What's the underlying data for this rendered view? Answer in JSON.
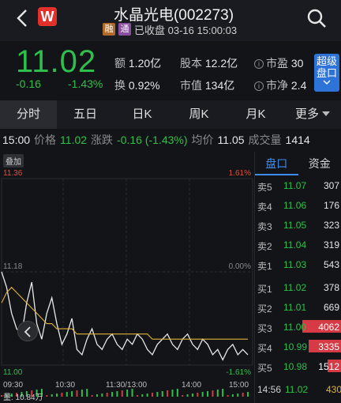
{
  "header": {
    "title": "水晶光电(002273)",
    "logo_text": "W",
    "tag_rong": "融",
    "tag_tong": "通",
    "status": "已收盘 03-16 15:00:03"
  },
  "quote": {
    "price": "11.02",
    "change": "-0.16",
    "change_pct": "-1.43%",
    "amount_label": "额",
    "amount": "1.20亿",
    "turnover_label": "换",
    "turnover": "0.92%",
    "shares_label": "股本",
    "shares": "12.2亿",
    "mktcap_label": "市值",
    "mktcap": "134亿",
    "pe_label": "市盈",
    "pe": "30",
    "pb_label": "市净",
    "pb": "2.4",
    "super_btn": "超级盘口"
  },
  "tabs": [
    "分时",
    "五日",
    "日K",
    "周K",
    "月K",
    "更多"
  ],
  "status_line": {
    "time": "15:00",
    "price_label": "价格",
    "price": "11.02",
    "change_label": "涨跌",
    "change": "-0.16 (-1.43%)",
    "avg_label": "均价",
    "avg": "11.05",
    "volume_label": "成交量",
    "volume": "1414"
  },
  "chart_labels": {
    "overlay": "叠加",
    "y_top": "11.36",
    "y_top_pct": "1.61%",
    "y_mid": "11.18",
    "y_mid_pct": "0.00%",
    "y_bot": "11.00",
    "y_bot_pct": "-1.61%",
    "x_ticks": [
      "09:30",
      "10:30",
      "11:30/13:00",
      "14:00",
      "15:00"
    ],
    "volume_text": "量: 10.84万"
  },
  "chart_data": {
    "type": "line",
    "x_ticks": [
      "09:30",
      "10:30",
      "11:30/13:00",
      "14:00",
      "15:00"
    ],
    "ylim": [
      11.0,
      11.36
    ],
    "prev_close": 11.18,
    "series": [
      {
        "values": [
          11.18,
          11.15,
          11.1,
          11.07,
          11.06,
          11.12,
          11.16,
          11.08,
          11.05,
          11.1,
          11.13,
          11.08,
          11.04,
          11.06,
          11.09,
          11.03,
          11.02,
          11.05,
          11.07,
          11.04,
          11.03,
          11.05,
          11.06,
          11.04,
          11.03,
          11.05,
          11.04,
          11.06,
          11.05,
          11.03,
          11.02,
          11.04,
          11.05,
          11.06,
          11.04,
          11.03,
          11.05,
          11.06,
          11.04,
          11.03,
          11.05,
          11.04,
          11.02,
          11.03,
          11.01,
          11.03,
          11.04,
          11.02,
          11.03,
          11.02
        ]
      },
      {
        "values": [
          11.12,
          11.14,
          11.15,
          11.14,
          11.13,
          11.12,
          11.11,
          11.1,
          11.09,
          11.08,
          11.08,
          11.07,
          11.07,
          11.07,
          11.07,
          11.06,
          11.06,
          11.06,
          11.06,
          11.06,
          11.06,
          11.06,
          11.06,
          11.06,
          11.06,
          11.06,
          11.06,
          11.06,
          11.06,
          11.06,
          11.05,
          11.05,
          11.05,
          11.05,
          11.05,
          11.05,
          11.05,
          11.05,
          11.05,
          11.05,
          11.05,
          11.05,
          11.05,
          11.05,
          11.05,
          11.05,
          11.05,
          11.05,
          11.05,
          11.05
        ]
      }
    ],
    "colors": {
      "price": "#e8e8e8",
      "avg": "#e0b23a"
    }
  },
  "order_book": {
    "tabs": [
      "盘口",
      "资金"
    ],
    "asks": [
      {
        "label": "卖5",
        "price": "11.07",
        "vol": "307"
      },
      {
        "label": "卖4",
        "price": "11.06",
        "vol": "176"
      },
      {
        "label": "卖3",
        "price": "11.05",
        "vol": "323"
      },
      {
        "label": "卖2",
        "price": "11.04",
        "vol": "319"
      },
      {
        "label": "卖1",
        "price": "11.03",
        "vol": "543"
      }
    ],
    "bids": [
      {
        "label": "买1",
        "price": "11.02",
        "vol": "378",
        "bar": 0
      },
      {
        "label": "买2",
        "price": "11.01",
        "vol": "669",
        "bar": 0
      },
      {
        "label": "买3",
        "price": "11.00",
        "vol": "4062",
        "bar": 0.85
      },
      {
        "label": "买4",
        "price": "10.99",
        "vol": "3335",
        "bar": 0.7
      },
      {
        "label": "买5",
        "price": "10.98",
        "vol": "1512",
        "bar": 0.3
      }
    ],
    "last_tick": {
      "time": "14:56",
      "price": "11.02",
      "vol": "430"
    }
  }
}
